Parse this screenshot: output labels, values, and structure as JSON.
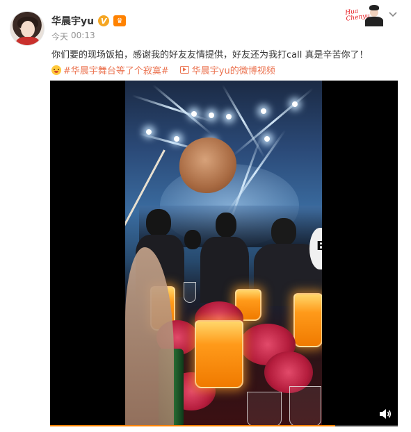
{
  "post": {
    "username": "华晨宇yu",
    "verified_badge": "V",
    "time_day": "今天",
    "time_clock": "00:13",
    "text": "你们要的现场饭拍，感谢我的好友友情提供，好友还为我打call 真是辛苦你了！",
    "topic_link": "#华晨宇舞台等了个寂寞#",
    "video_link": "华晨宇yu的微博视频",
    "corner_signature": "Hua Chenyu 华晨宇"
  },
  "video": {
    "progress_fraction": 0.82
  },
  "colors": {
    "link": "#eb7350",
    "badge_v": "#f5a623",
    "accent": "#ff8200"
  }
}
